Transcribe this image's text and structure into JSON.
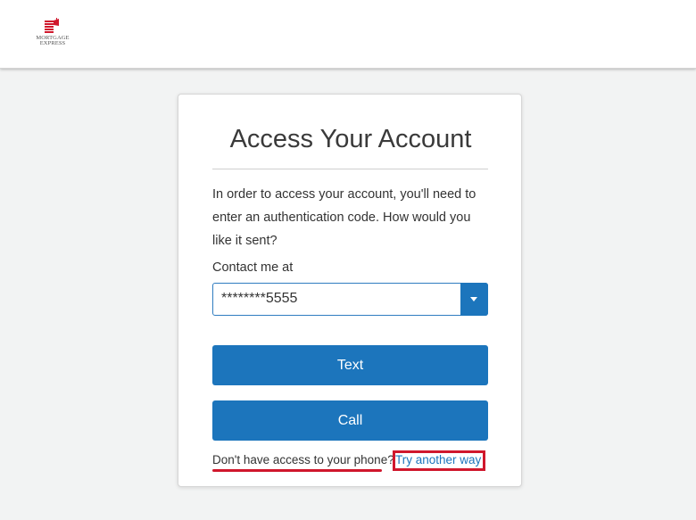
{
  "header": {
    "logo": {
      "line1": "MORTGAGE",
      "line2": "EXPRESS",
      "color": "#d0172c"
    }
  },
  "card": {
    "title": "Access Your Account",
    "instructions": "In order to access your account, you'll need to enter an authentication code. How would you like it sent?",
    "contact_label": "Contact me at",
    "contact_select": {
      "value": "********5555",
      "icon": "chevron-down-icon"
    },
    "buttons": {
      "text": "Text",
      "call": "Call"
    },
    "help": {
      "question": "Don't have access to your phone?",
      "link": "Try another way"
    }
  },
  "colors": {
    "primary": "#1c75bc",
    "annotation_red": "#d0172c",
    "background": "#f2f3f3"
  }
}
